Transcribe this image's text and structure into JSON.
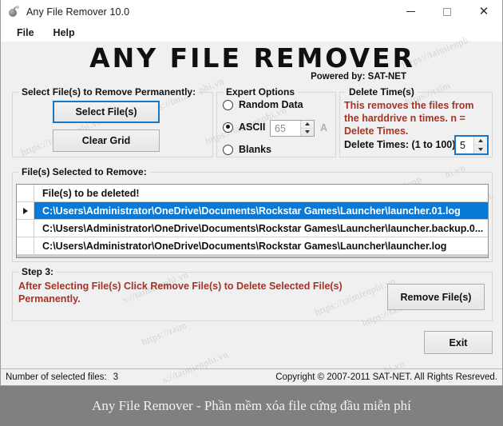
{
  "window": {
    "title": "Any File Remover 10.0",
    "icon": "bomb-icon",
    "controls": {
      "minimize": "minimize-icon",
      "maximize": "maximize-icon",
      "close": "close-icon"
    }
  },
  "menubar": {
    "items": [
      {
        "label": "File"
      },
      {
        "label": "Help"
      }
    ]
  },
  "branding": {
    "logo": "ANY FILE REMOVER",
    "powered_by": "Powered by: SAT-NET"
  },
  "select_files_group": {
    "legend": "Select File(s) to Remove Permanently:",
    "select_button": "Select File(s)",
    "clear_button": "Clear Grid"
  },
  "expert_options_group": {
    "legend": "Expert Options",
    "options": [
      {
        "label": "Random Data",
        "selected": false
      },
      {
        "label": "ASCII",
        "selected": true
      },
      {
        "label": "Blanks",
        "selected": false
      }
    ],
    "ascii_value": "65",
    "ascii_char": "A"
  },
  "delete_times_group": {
    "legend": "Delete Time(s)",
    "description": "This removes the files from the harddrive n times. n = Delete Times.",
    "field_label": "Delete Times: (1 to 100)",
    "value": "5"
  },
  "files_group": {
    "legend": "File(s) Selected to Remove:",
    "column_header": "File(s) to be deleted!",
    "rows": [
      {
        "path": "C:\\Users\\Administrator\\OneDrive\\Documents\\Rockstar Games\\Launcher\\launcher.01.log",
        "selected": true,
        "marker": "row-caret-icon"
      },
      {
        "path": "C:\\Users\\Administrator\\OneDrive\\Documents\\Rockstar Games\\Launcher\\launcher.backup.0...",
        "selected": false,
        "marker": ""
      },
      {
        "path": "C:\\Users\\Administrator\\OneDrive\\Documents\\Rockstar Games\\Launcher\\launcher.log",
        "selected": false,
        "marker": ""
      }
    ]
  },
  "step3_group": {
    "legend": "Step 3:",
    "description": "After Selecting File(s) Click Remove File(s) to Delete Selected File(s) Permanently.",
    "remove_button": "Remove File(s)"
  },
  "exit_button": "Exit",
  "statusbar": {
    "selected_label": "Number of selected files:",
    "selected_count": "3",
    "copyright": "Copyright © 2007-2011 SAT-NET. All Rights Resreved."
  },
  "caption": "Any File Remover - Phần mềm xóa file cứng đầu miễn phí",
  "watermarks": [
    "https://taimienph.",
    "https://taimienphi.vn",
    "https://taimienphi.vn",
    "https://taimienphi.vn",
    "https://taimienphi.vn",
    "s://taimienphi.vn",
    "https://taim",
    "s://taimienphi.",
    "https://taimienp",
    "hi.vn"
  ],
  "colors": {
    "accent_blue": "#0a7ad8",
    "focus_blue": "#1878c8",
    "warning_red": "#a93226",
    "window_bg": "#f0f0f0",
    "caption_bg": "#808080"
  }
}
